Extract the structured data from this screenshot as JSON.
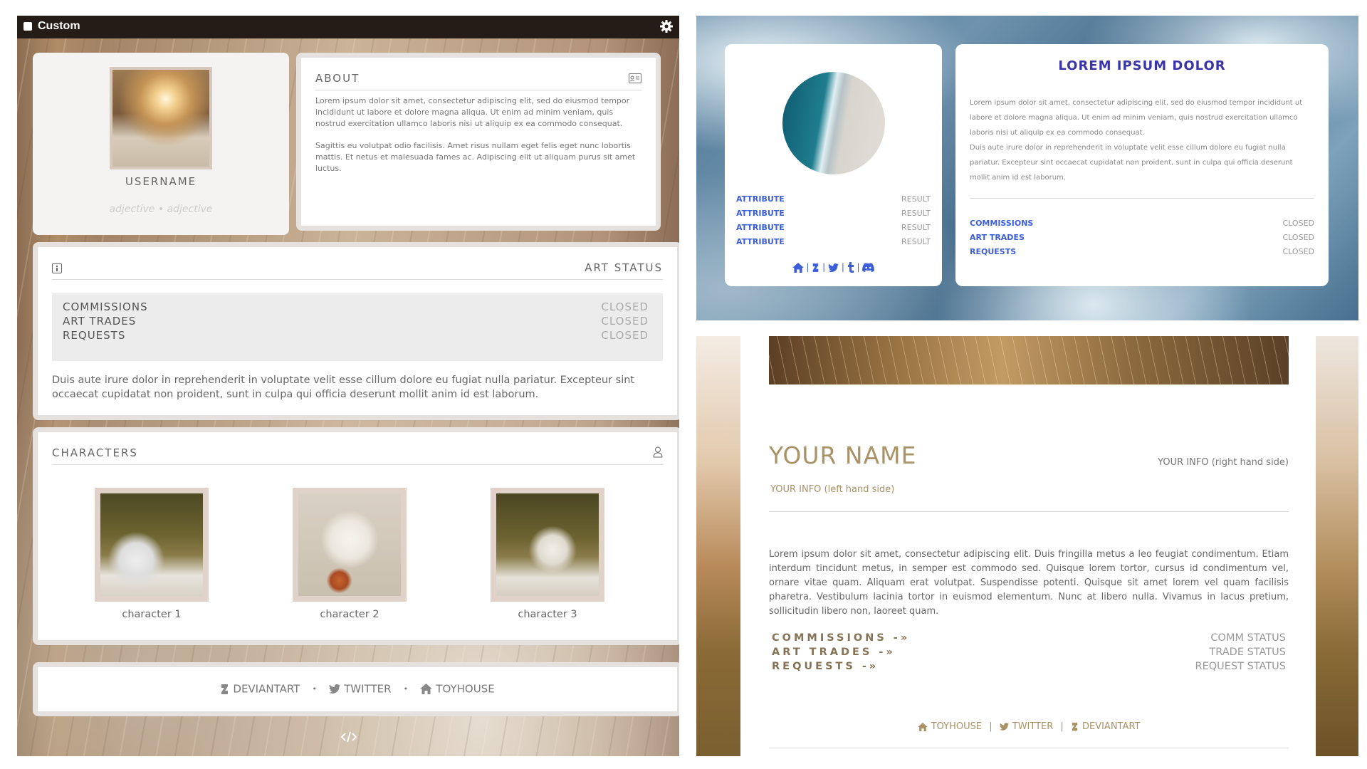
{
  "window": {
    "title": "Custom"
  },
  "left_panel": {
    "profile": {
      "username": "USERNAME",
      "adjectives": "adjective • adjective"
    },
    "about": {
      "heading": "ABOUT",
      "paragraph_1": "Lorem ipsum dolor sit amet, consectetur adipiscing elit, sed do eiusmod tempor incididunt ut labore et dolore magna aliqua. Ut enim ad minim veniam, quis nostrud exercitation ullamco laboris nisi ut aliquip ex ea commodo consequat.",
      "paragraph_2": "Sagittis eu volutpat odio facilisis. Amet risus nullam eget felis eget nunc lobortis mattis. Et netus et malesuada fames ac. Adipiscing elit ut aliquam purus sit amet luctus."
    },
    "art_status": {
      "heading": "ART STATUS",
      "rows": [
        {
          "label": "COMMISSIONS",
          "value": "CLOSED"
        },
        {
          "label": "ART TRADES",
          "value": "CLOSED"
        },
        {
          "label": "REQUESTS",
          "value": "CLOSED"
        }
      ],
      "text": "Duis aute irure dolor in reprehenderit in voluptate velit esse cillum dolore eu fugiat nulla pariatur. Excepteur sint occaecat cupidatat non proident, sunt in culpa qui officia deserunt mollit anim id est laborum."
    },
    "characters": {
      "heading": "CHARACTERS",
      "items": [
        {
          "label": "character 1"
        },
        {
          "label": "character 2"
        },
        {
          "label": "character 3"
        }
      ]
    },
    "links": [
      {
        "label": "DEVIANTART",
        "icon": "deviantart-icon"
      },
      {
        "label": "TWITTER",
        "icon": "twitter-icon"
      },
      {
        "label": "TOYHOUSE",
        "icon": "home-icon"
      }
    ],
    "separator": "•"
  },
  "top_right": {
    "attributes": [
      {
        "label": "ATTRIBUTE",
        "value": "RESULT"
      },
      {
        "label": "ATTRIBUTE",
        "value": "RESULT"
      },
      {
        "label": "ATTRIBUTE",
        "value": "RESULT"
      },
      {
        "label": "ATTRIBUTE",
        "value": "RESULT"
      }
    ],
    "title": "LOREM IPSUM DOLOR",
    "paragraph_1": "Lorem ipsum dolor sit amet, consectetur adipiscing elit, sed do eiusmod tempor incididunt ut labore et dolore magna aliqua. Ut enim ad minim veniam, quis nostrud exercitation ullamco laboris nisi ut aliquip ex ea commodo consequat.",
    "paragraph_2": "Duis aute irure dolor in reprehenderit in voluptate velit esse cillum dolore eu fugiat nulla pariatur. Excepteur sint occaecat cupidatat non proident, sunt in culpa qui officia deserunt mollit anim id est laborum.",
    "status": [
      {
        "label": "COMMISSIONS",
        "value": "CLOSED"
      },
      {
        "label": "ART TRADES",
        "value": "CLOSED"
      },
      {
        "label": "REQUESTS",
        "value": "CLOSED"
      }
    ],
    "social_separator": "|"
  },
  "bottom_right": {
    "name": "YOUR NAME",
    "info_right": "YOUR INFO (right hand side)",
    "info_left": "YOUR INFO (left hand side)",
    "paragraph": "Lorem ipsum dolor sit amet, consectetur adipiscing elit. Duis fringilla metus a leo feugiat condimentum. Etiam interdum tincidunt metus, in semper est commodo sed. Quisque lorem tortor, cursus id condimentum vel, ornare vitae quam. Aliquam erat volutpat. Suspendisse potenti. Quisque sit amet lorem vel quam facilisis pharetra. Vestibulum lacinia tortor in euismod elementum. Nunc at libero nulla. Vivamus in lacus pretium, sollicitudin libero non, laoreet quam.",
    "status": [
      {
        "label": "COMMISSIONS -»",
        "value": "COMM STATUS"
      },
      {
        "label": "ART TRADES -»",
        "value": "TRADE STATUS"
      },
      {
        "label": "REQUESTS -»",
        "value": "REQUEST STATUS"
      }
    ],
    "links": [
      {
        "label": "TOYHOUSE",
        "icon": "home-icon"
      },
      {
        "label": "TWITTER",
        "icon": "twitter-icon"
      },
      {
        "label": "DEVIANTART",
        "icon": "deviantart-icon"
      }
    ],
    "separator": "|"
  },
  "colors": {
    "titlebar": "#251c18",
    "blue_accent": "#3c5ed8",
    "title_purple": "#3a34a8",
    "gold_accent": "#a89266"
  }
}
